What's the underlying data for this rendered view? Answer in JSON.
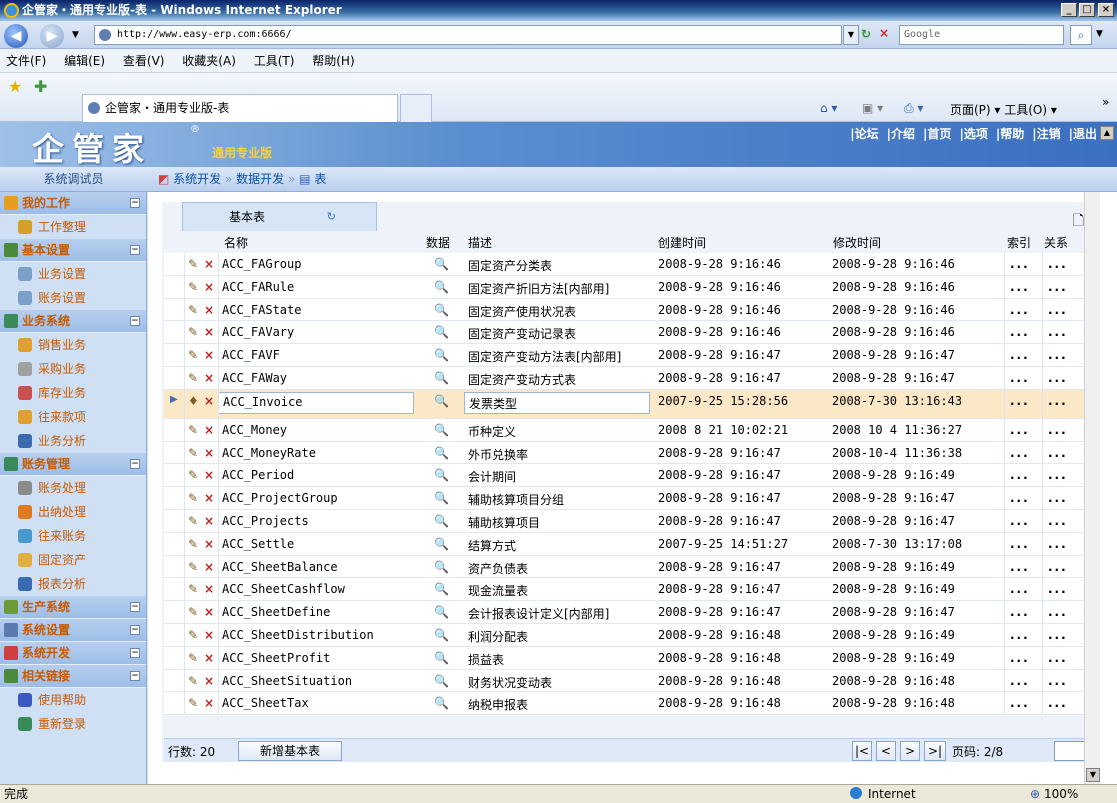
{
  "window": {
    "title": "企管家・通用专业版-表 - Windows Internet Explorer",
    "min": "_",
    "max": "□",
    "close": "×"
  },
  "address": {
    "url": "http://www.easy-erp.com:6666/",
    "search_placeholder": "Google"
  },
  "menu": [
    "文件(F)",
    "编辑(E)",
    "查看(V)",
    "收藏夹(A)",
    "工具(T)",
    "帮助(H)"
  ],
  "fav": {
    "tab_title": "企管家・通用专业版-表",
    "right_tools": "页面(P) ▾   工具(O) ▾"
  },
  "app": {
    "logo": "企管家",
    "edition": "通用专业版",
    "links": [
      "|论坛",
      "|介绍",
      "|首页",
      "|选项",
      "|帮助",
      "|注销",
      "|退出"
    ]
  },
  "subhead": {
    "user": "系统调试员",
    "crumb": [
      "系统开发",
      "数据开发",
      "表"
    ]
  },
  "sidebar": [
    {
      "head": "我的工作",
      "color": "#e59d1e",
      "items": [
        {
          "label": "工作整理",
          "color": "#d4a02a"
        }
      ]
    },
    {
      "head": "基本设置",
      "color": "#4a8a3a",
      "items": [
        {
          "label": "业务设置",
          "color": "#7aa0c8"
        },
        {
          "label": "账务设置",
          "color": "#7aa0c8"
        }
      ]
    },
    {
      "head": "业务系统",
      "color": "#3a8a5a",
      "items": [
        {
          "label": "销售业务",
          "color": "#e0a030"
        },
        {
          "label": "采购业务",
          "color": "#a0a0a0"
        },
        {
          "label": "库存业务",
          "color": "#c85050"
        },
        {
          "label": "往来款项",
          "color": "#e0a030"
        },
        {
          "label": "业务分析",
          "color": "#3a6ab0"
        }
      ]
    },
    {
      "head": "账务管理",
      "color": "#3a8a5a",
      "items": [
        {
          "label": "账务处理",
          "color": "#8a8a8a"
        },
        {
          "label": "出纳处理",
          "color": "#e07a20"
        },
        {
          "label": "往来账务",
          "color": "#4a9ad0"
        },
        {
          "label": "固定资产",
          "color": "#e0b040"
        },
        {
          "label": "报表分析",
          "color": "#3a6ab0"
        }
      ]
    },
    {
      "head": "生产系统",
      "color": "#6a9a3a",
      "items": []
    },
    {
      "head": "系统设置",
      "color": "#5a7ab0",
      "items": []
    },
    {
      "head": "系统开发",
      "color": "#d04040",
      "items": []
    },
    {
      "head": "相关链接",
      "color": "#4a8a3a",
      "items": [
        {
          "label": "使用帮助",
          "color": "#3a5ac0"
        },
        {
          "label": "重新登录",
          "color": "#3a8a5a"
        }
      ]
    }
  ],
  "grid": {
    "tab": "基本表",
    "headers": {
      "name": "名称",
      "data": "数据",
      "desc": "描述",
      "created": "创建时间",
      "modified": "修改时间",
      "index": "索引",
      "relation": "关系"
    },
    "rows": [
      {
        "name": "ACC_FAGroup",
        "desc": "固定资产分类表",
        "created": "2008-9-28 9:16:46",
        "modified": "2008-9-28 9:16:46"
      },
      {
        "name": "ACC_FARule",
        "desc": "固定资产折旧方法[内部用]",
        "created": "2008-9-28 9:16:46",
        "modified": "2008-9-28 9:16:46"
      },
      {
        "name": "ACC_FAState",
        "desc": "固定资产使用状况表",
        "created": "2008-9-28 9:16:46",
        "modified": "2008-9-28 9:16:46"
      },
      {
        "name": "ACC_FAVary",
        "desc": "固定资产变动记录表",
        "created": "2008-9-28 9:16:46",
        "modified": "2008-9-28 9:16:46"
      },
      {
        "name": "ACC_FAVF",
        "desc": "固定资产变动方法表[内部用]",
        "created": "2008-9-28 9:16:47",
        "modified": "2008-9-28 9:16:47"
      },
      {
        "name": "ACC_FAWay",
        "desc": "固定资产变动方式表",
        "created": "2008-9-28 9:16:47",
        "modified": "2008-9-28 9:16:47"
      },
      {
        "name": "ACC_Invoice",
        "desc": "发票类型",
        "created": "2007-9-25 15:28:56",
        "modified": "2008-7-30 13:16:43",
        "selected": true
      },
      {
        "name": "ACC_Money",
        "desc": "币种定义",
        "created": "2008 8 21 10:02:21",
        "modified": "2008 10 4 11:36:27"
      },
      {
        "name": "ACC_MoneyRate",
        "desc": "外币兑换率",
        "created": "2008-9-28 9:16:47",
        "modified": "2008-10-4 11:36:38"
      },
      {
        "name": "ACC_Period",
        "desc": "会计期间",
        "created": "2008-9-28 9:16:47",
        "modified": "2008-9-28 9:16:49"
      },
      {
        "name": "ACC_ProjectGroup",
        "desc": "辅助核算项目分组",
        "created": "2008-9-28 9:16:47",
        "modified": "2008-9-28 9:16:47"
      },
      {
        "name": "ACC_Projects",
        "desc": "辅助核算项目",
        "created": "2008-9-28 9:16:47",
        "modified": "2008-9-28 9:16:47"
      },
      {
        "name": "ACC_Settle",
        "desc": "结算方式",
        "created": "2007-9-25 14:51:27",
        "modified": "2008-7-30 13:17:08"
      },
      {
        "name": "ACC_SheetBalance",
        "desc": "资产负债表",
        "created": "2008-9-28 9:16:47",
        "modified": "2008-9-28 9:16:49"
      },
      {
        "name": "ACC_SheetCashflow",
        "desc": "现金流量表",
        "created": "2008-9-28 9:16:47",
        "modified": "2008-9-28 9:16:49"
      },
      {
        "name": "ACC_SheetDefine",
        "desc": "会计报表设计定义[内部用]",
        "created": "2008-9-28 9:16:47",
        "modified": "2008-9-28 9:16:47"
      },
      {
        "name": "ACC_SheetDistribution",
        "desc": "利润分配表",
        "created": "2008-9-28 9:16:48",
        "modified": "2008-9-28 9:16:49"
      },
      {
        "name": "ACC_SheetProfit",
        "desc": "损益表",
        "created": "2008-9-28 9:16:48",
        "modified": "2008-9-28 9:16:49"
      },
      {
        "name": "ACC_SheetSituation",
        "desc": "财务状况变动表",
        "created": "2008-9-28 9:16:48",
        "modified": "2008-9-28 9:16:48"
      },
      {
        "name": "ACC_SheetTax",
        "desc": "纳税申报表",
        "created": "2008-9-28 9:16:48",
        "modified": "2008-9-28 9:16:48"
      }
    ],
    "ellipsis": "...",
    "footer": {
      "row_count_label": "行数: 20",
      "add_button": "新增基本表",
      "page_label": "页码: 2/8",
      "nav": [
        "|<",
        "<",
        ">",
        ">|"
      ]
    }
  },
  "status": {
    "left": "完成",
    "zone": "Internet",
    "zoom": "100%"
  }
}
